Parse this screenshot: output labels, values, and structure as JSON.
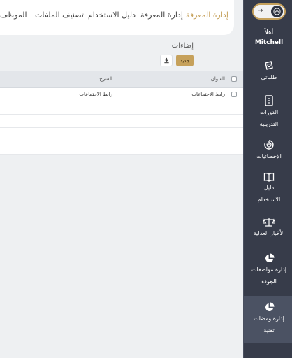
{
  "tabs": [
    {
      "label": "إدارة المعرفة",
      "active": true
    },
    {
      "label": "إدارة المعرفة",
      "active": false
    },
    {
      "label": "دليل الاستخدام",
      "active": false
    },
    {
      "label": "تصنيف الملفات",
      "active": false
    },
    {
      "label": "الموظف",
      "active": false
    }
  ],
  "section": {
    "title": "إضاءات",
    "new_button": "جديد",
    "export_icon": "download-icon"
  },
  "table": {
    "headers": {
      "title": "العنوان",
      "description": "الشرح"
    },
    "rows": [
      {
        "title": "رابط الاجتماعات",
        "description": "رابط الاجتماعات"
      },
      {
        "title": "",
        "description": ""
      },
      {
        "title": "",
        "description": ""
      },
      {
        "title": "",
        "description": ""
      },
      {
        "title": "",
        "description": ""
      }
    ]
  },
  "sidebar": {
    "toggle_icon": "collapse-arrow-icon",
    "greeting": "أهلاً",
    "user_name": "Mitchell",
    "items": [
      {
        "icon": "requests-icon",
        "label_lines": [
          "طلباتي"
        ],
        "active": false
      },
      {
        "icon": "courses-icon",
        "label_lines": [
          "الدورات",
          "التدريبية"
        ],
        "active": false
      },
      {
        "icon": "statistics-icon",
        "label_lines": [
          "الإحصائيات"
        ],
        "active": false
      },
      {
        "icon": "guide-book-icon",
        "label_lines": [
          "دليل",
          "الاستخدام"
        ],
        "active": false
      },
      {
        "icon": "scales-icon",
        "label_lines": [
          "الأخبار العدلية"
        ],
        "active": false
      },
      {
        "icon": "pie-chart-icon",
        "label_lines": [
          "إدارة مواصفات",
          "الجودة"
        ],
        "active": false
      },
      {
        "icon": "pie-chart-icon",
        "label_lines": [
          "إدارة ومضات",
          "تقنية"
        ],
        "active": true
      }
    ]
  },
  "colors": {
    "accent": "#c6a15b",
    "sidebar_bg": "#373c4a",
    "sidebar_active": "#4b5263",
    "page_bg": "#eef0f2",
    "table_header_bg": "#e3e6ea"
  }
}
